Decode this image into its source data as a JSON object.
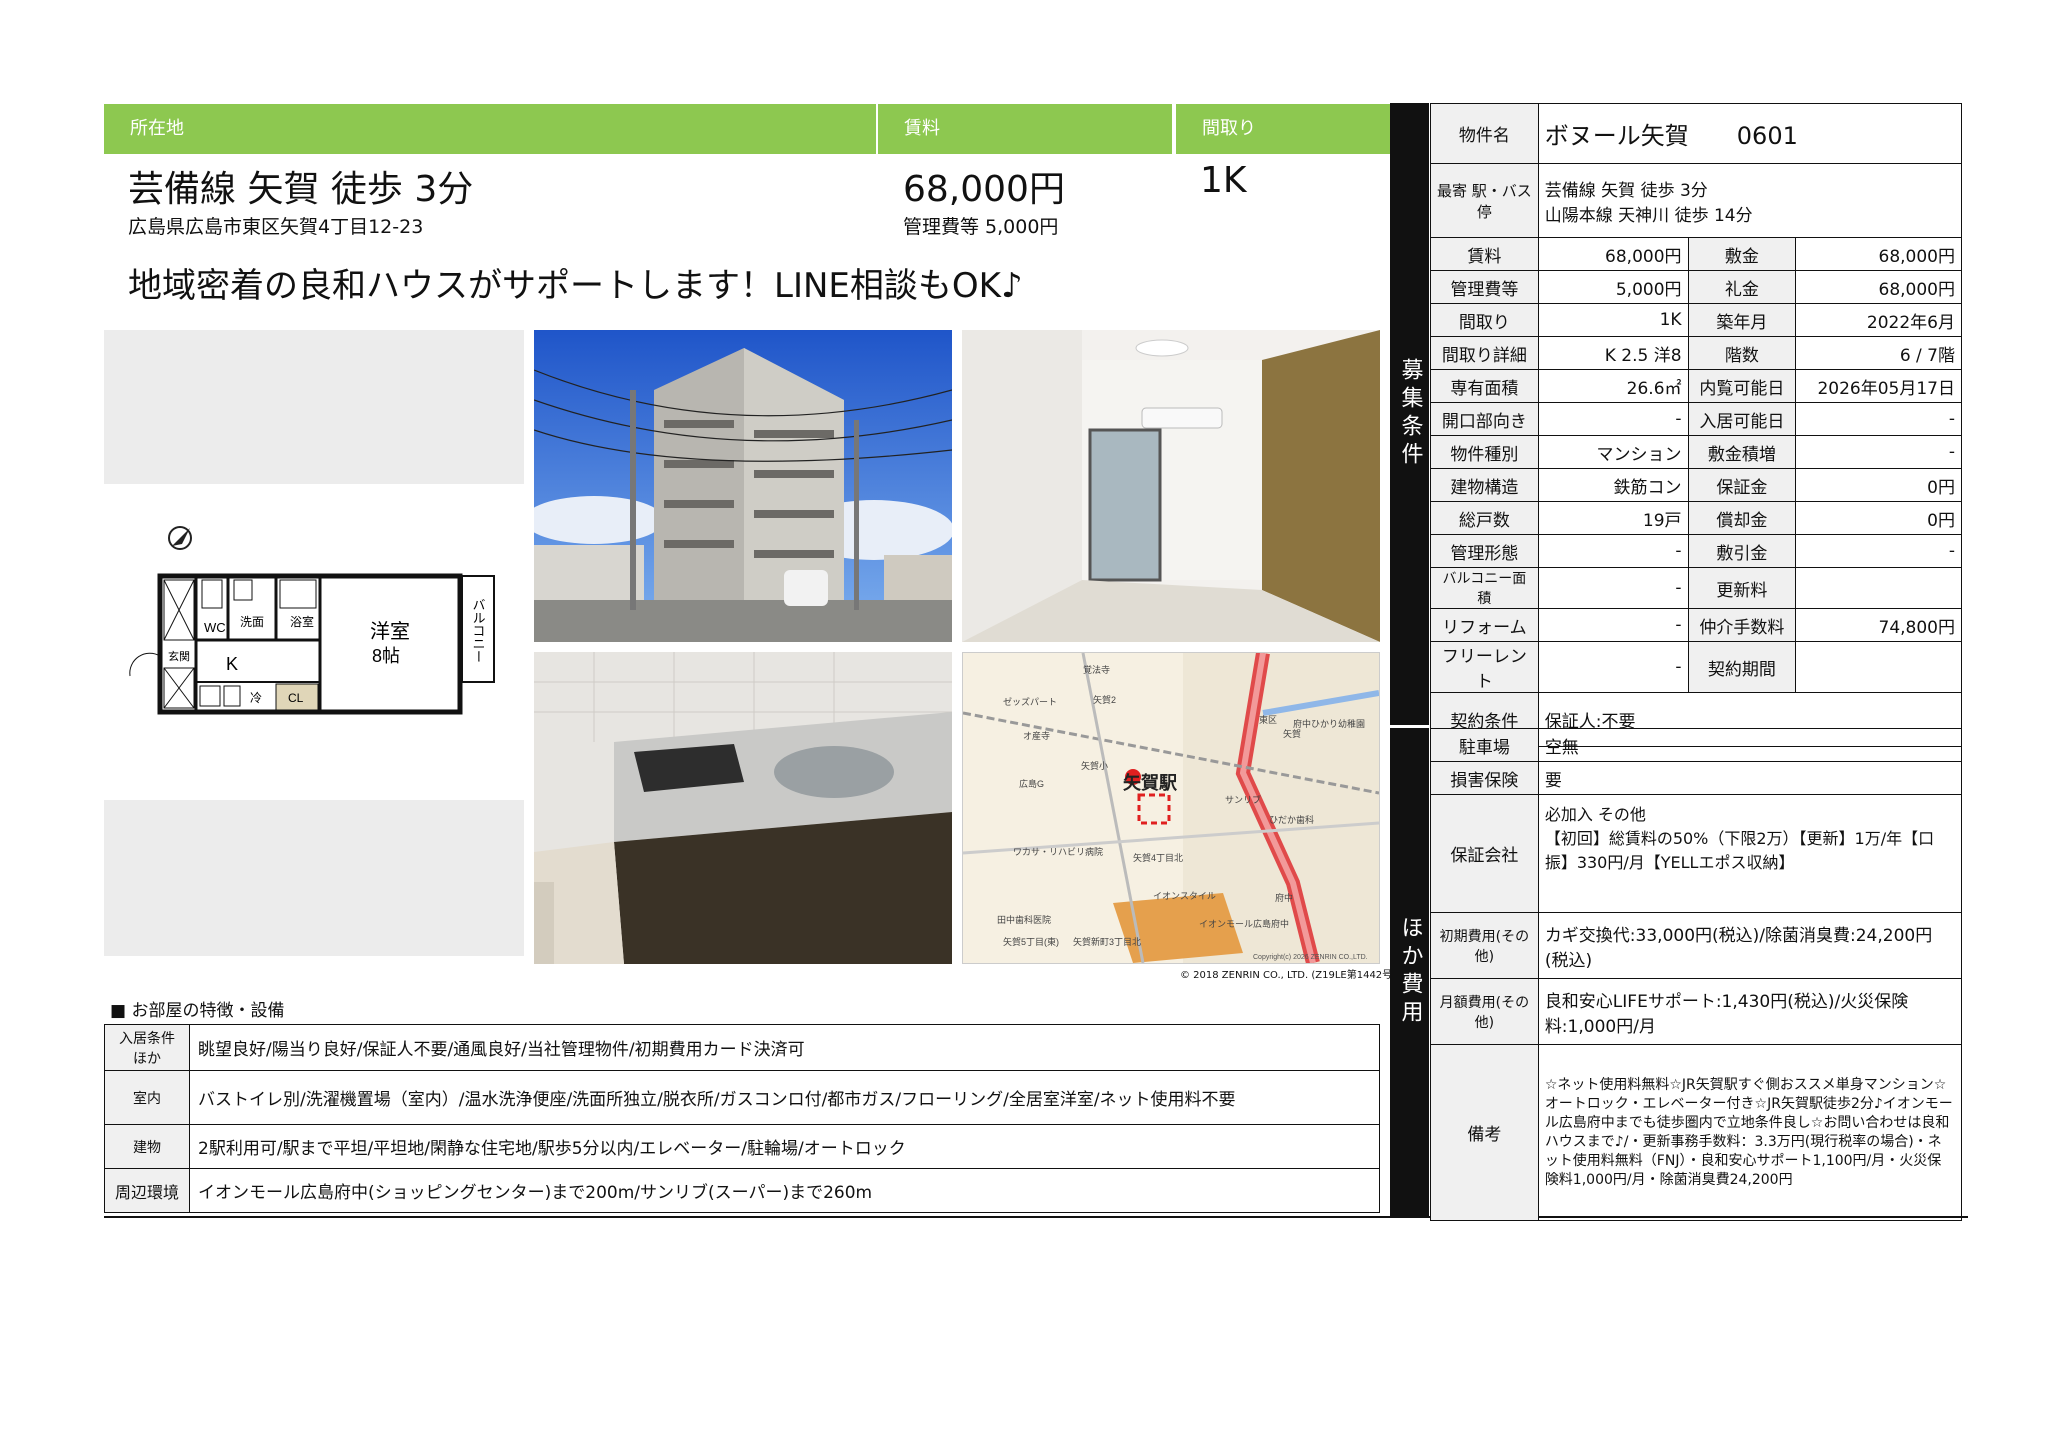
{
  "header": {
    "location_label": "所在地",
    "rent_label": "賃料",
    "layout_label": "間取り",
    "access": "芸備線 矢賀 徒歩 3分",
    "address": "広島県広島市東区矢賀4丁目12-23",
    "rent": "68,000円",
    "management_fee": "管理費等 5,000円",
    "layout": "1K",
    "catchphrase": "地域密着の良和ハウスがサポートします！LINE相談もOK♪"
  },
  "floorplan": {
    "wc": "WC",
    "senmen": "洗面",
    "yokushitsu": "浴室",
    "genkan": "玄関",
    "k": "K",
    "rei": "冷",
    "cl": "CL",
    "room": "洋室",
    "room_size": "8帖",
    "balcony": "バルコニー"
  },
  "map": {
    "station": "矢賀駅",
    "labels": [
      "覚法寺",
      "矢賀2",
      "ゼッズパート",
      "オ産寺",
      "矢賀小",
      "広島G",
      "ワカサ・リハビリ病院",
      "矢賀4丁目北",
      "田中歯科医院",
      "イオンスタイル",
      "イオンモール広島府中",
      "矢賀5丁目(東)",
      "矢賀新町3丁目北",
      "府中",
      "矢賀",
      "東区",
      "サンリブ",
      "ひだか歯科",
      "府中ひかり幼稚園"
    ],
    "copyright_inner": "Copyright(c) 2026 ZENRIN CO.,LTD.",
    "copyright": "© 2018 ZENRIN CO., LTD. (Z19LE第1442号)"
  },
  "features": {
    "heading": "■ お部屋の特徴・設備",
    "rows": [
      {
        "label": "入居条件ほか",
        "value": "眺望良好/陽当り良好/保証人不要/通風良好/当社管理物件/初期費用カード決済可"
      },
      {
        "label": "室内",
        "value": "バストイレ別/洗濯機置場（室内）/温水洗浄便座/洗面所独立/脱衣所/ガスコンロ付/都市ガス/フローリング/全居室洋室/ネット使用料不要"
      },
      {
        "label": "建物",
        "value": "2駅利用可/駅まで平坦/平坦地/閑静な住宅地/駅歩5分以内/エレベーター/駐輪場/オートロック"
      },
      {
        "label": "周辺環境",
        "value": "イオンモール広島府中(ショッピングセンター)まで200m/サンリブ(スーパー)まで260m"
      }
    ]
  },
  "spec": {
    "sidebar_top": "募集条件",
    "sidebar_bottom": "ほか費用",
    "name_label": "物件名",
    "name": "ボヌール矢賀　　0601",
    "station_label": "最寄 駅・バス停",
    "station_1": "芸備線 矢賀 徒歩 3分",
    "station_2": "山陽本線 天神川 徒歩 14分",
    "rows": [
      [
        "賃料",
        "68,000円",
        "敷金",
        "68,000円"
      ],
      [
        "管理費等",
        "5,000円",
        "礼金",
        "68,000円"
      ],
      [
        "間取り",
        "1K",
        "築年月",
        "2022年6月"
      ],
      [
        "間取り詳細",
        "K 2.5 洋8",
        "階数",
        "6 / 7階"
      ],
      [
        "専有面積",
        "26.6㎡",
        "内覧可能日",
        "2026年05月17日"
      ],
      [
        "開口部向き",
        "-",
        "入居可能日",
        "-"
      ],
      [
        "物件種別",
        "マンション",
        "敷金積増",
        "-"
      ],
      [
        "建物構造",
        "鉄筋コン",
        "保証金",
        "0円"
      ],
      [
        "総戸数",
        "19戸",
        "償却金",
        "0円"
      ],
      [
        "管理形態",
        "-",
        "敷引金",
        "-"
      ],
      [
        "バルコニー面積",
        "-",
        "更新料",
        ""
      ],
      [
        "リフォーム",
        "-",
        "仲介手数料",
        "74,800円"
      ],
      [
        "フリーレント",
        "-",
        "契約期間",
        ""
      ]
    ],
    "contract_label": "契約条件",
    "contract": "保証人:不要",
    "other": [
      {
        "label": "駐車場",
        "value": "空無"
      },
      {
        "label": "損害保険",
        "value": "要"
      },
      {
        "label": "保証会社",
        "value": "必加入 その他\n【初回】総賃料の50%（下限2万）【更新】1万/年【口振】330円/月【YELLエポス収納】"
      },
      {
        "label": "初期費用(その他)",
        "value": "カギ交換代:33,000円(税込)/除菌消臭費:24,200円(税込)"
      },
      {
        "label": "月額費用(その他)",
        "value": "良和安心LIFEサポート:1,430円(税込)/火災保険料:1,000円/月"
      },
      {
        "label": "備考",
        "value": "☆ネット使用料無料☆JR矢賀駅すぐ側おススメ単身マンション☆オートロック・エレベーター付き☆JR矢賀駅徒歩2分♪イオンモール広島府中までも徒歩圏内で立地条件良し☆お問い合わせは良和ハウスまで♪/・更新事務手数料：3.3万円(現行税率の場合)・ネット使用料無料（FNJ）・良和安心サポート1,100円/月・火災保険料1,000円/月・除菌消臭費24,200円"
      }
    ]
  }
}
